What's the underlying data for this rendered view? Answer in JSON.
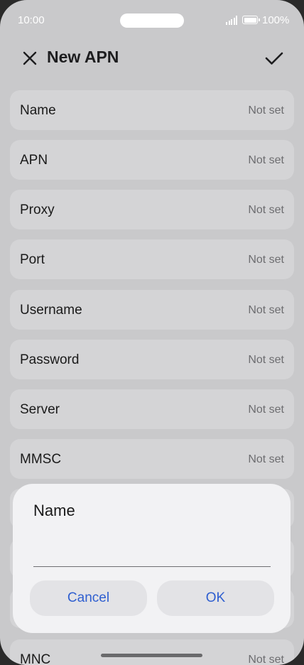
{
  "status": {
    "time": "10:00",
    "battery": "100%"
  },
  "header": {
    "title": "New APN"
  },
  "fields": [
    {
      "label": "Name",
      "value": "Not set"
    },
    {
      "label": "APN",
      "value": "Not set"
    },
    {
      "label": "Proxy",
      "value": "Not set"
    },
    {
      "label": "Port",
      "value": "Not set"
    },
    {
      "label": "Username",
      "value": "Not set"
    },
    {
      "label": "Password",
      "value": "Not set"
    },
    {
      "label": "Server",
      "value": "Not set"
    },
    {
      "label": "MMSC",
      "value": "Not set"
    },
    {
      "label": "MNC",
      "value": "Not set"
    }
  ],
  "dialog": {
    "title": "Name",
    "input_value": "",
    "cancel_label": "Cancel",
    "ok_label": "OK"
  }
}
